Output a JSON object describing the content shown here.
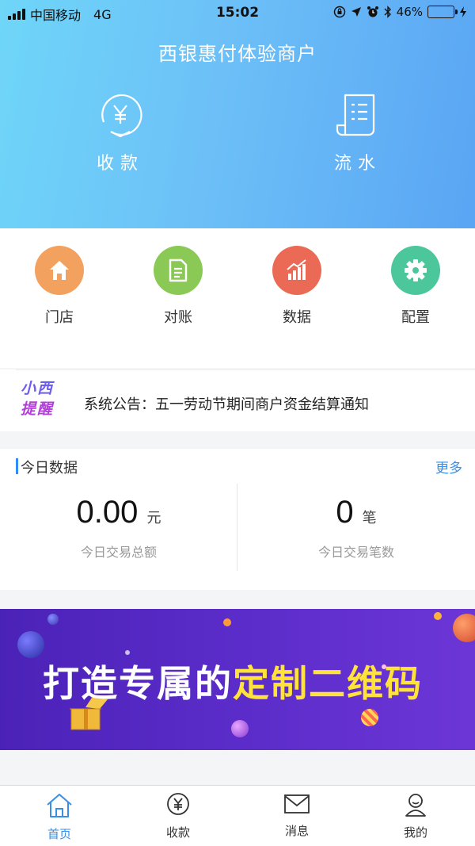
{
  "status_bar": {
    "carrier": "中国移动",
    "network": "4G",
    "time": "15:02",
    "battery": "46%",
    "battery_level": 0.46
  },
  "header": {
    "title": "西银惠付体验商户",
    "actions": [
      {
        "label": "收款",
        "icon": "yuan-circle-icon"
      },
      {
        "label": "流水",
        "icon": "receipt-icon"
      }
    ]
  },
  "quick_menu": [
    {
      "label": "门店",
      "icon": "home-icon",
      "color": "#f2a15f"
    },
    {
      "label": "对账",
      "icon": "document-icon",
      "color": "#8bc957"
    },
    {
      "label": "数据",
      "icon": "chart-icon",
      "color": "#ea6a55"
    },
    {
      "label": "配置",
      "icon": "gear-icon",
      "color": "#4cc79c"
    }
  ],
  "notice": {
    "logo_line1": "小西",
    "logo_line2": "提醒",
    "text": "系统公告：五一劳动节期间商户资金结算通知"
  },
  "today": {
    "title": "今日数据",
    "more": "更多",
    "amount": {
      "value": "0.00",
      "unit": "元",
      "label": "今日交易总额"
    },
    "count": {
      "value": "0",
      "unit": "笔",
      "label": "今日交易笔数"
    }
  },
  "banner": {
    "text_part1": "打造专属的",
    "text_part2": "定制二维码"
  },
  "tabbar": [
    {
      "label": "首页",
      "icon": "home-outline-icon",
      "active": true
    },
    {
      "label": "收款",
      "icon": "yuan-circle-icon",
      "active": false
    },
    {
      "label": "消息",
      "icon": "mail-icon",
      "active": false
    },
    {
      "label": "我的",
      "icon": "user-icon",
      "active": false
    }
  ],
  "colors": {
    "accent": "#3a8ee6",
    "banner_highlight": "#ffe23a"
  }
}
